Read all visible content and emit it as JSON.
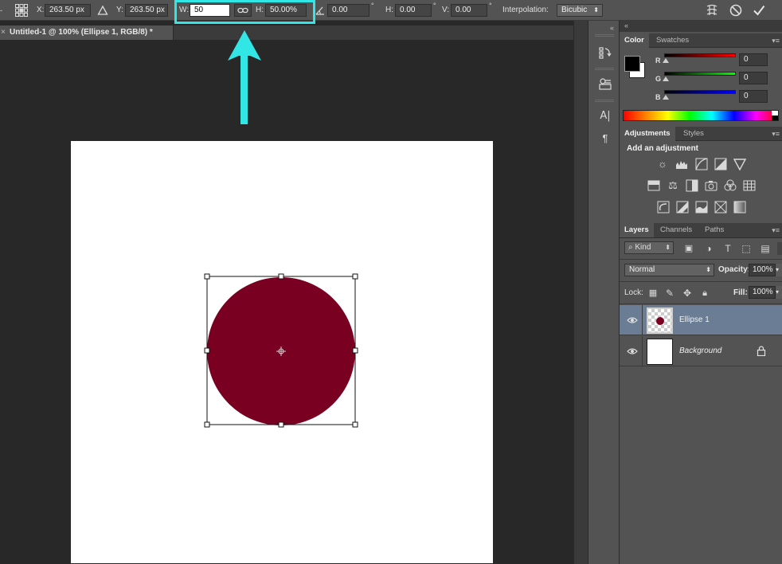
{
  "options_bar": {
    "x_label": "X:",
    "x_value": "263.50 px",
    "y_label": "Y:",
    "y_value": "263.50 px",
    "w_label": "W:",
    "w_value": "50",
    "h_label": "H:",
    "h_value": "50.00%",
    "angle_value": "0.00",
    "hskew_label": "H:",
    "hskew_value": "0.00",
    "vskew_label": "V:",
    "vskew_value": "0.00",
    "degree": "°",
    "interpolation_label": "Interpolation:",
    "interpolation_value": "Bicubic"
  },
  "document_tab": {
    "title": "Untitled-1 @ 100% (Ellipse 1, RGB/8) *",
    "close": "×"
  },
  "canvas": {
    "ellipse_color": "#7a0022"
  },
  "color_panel": {
    "tabs": [
      "Color",
      "Swatches"
    ],
    "r_label": "R",
    "g_label": "G",
    "b_label": "B",
    "r_value": "0",
    "g_value": "0",
    "b_value": "0"
  },
  "adjustments_panel": {
    "tabs": [
      "Adjustments",
      "Styles"
    ],
    "heading": "Add an adjustment"
  },
  "layers_panel": {
    "tabs": [
      "Layers",
      "Channels",
      "Paths"
    ],
    "filter_kind": "Kind",
    "blend_mode": "Normal",
    "opacity_label": "Opacity:",
    "opacity_value": "100%",
    "lock_label": "Lock:",
    "fill_label": "Fill:",
    "fill_value": "100%",
    "layers": [
      {
        "name": "Ellipse 1",
        "selected": true
      },
      {
        "name": "Background",
        "selected": false
      }
    ]
  },
  "colors": {
    "highlight": "#33e6e6",
    "selected_layer": "#6b7d94"
  }
}
